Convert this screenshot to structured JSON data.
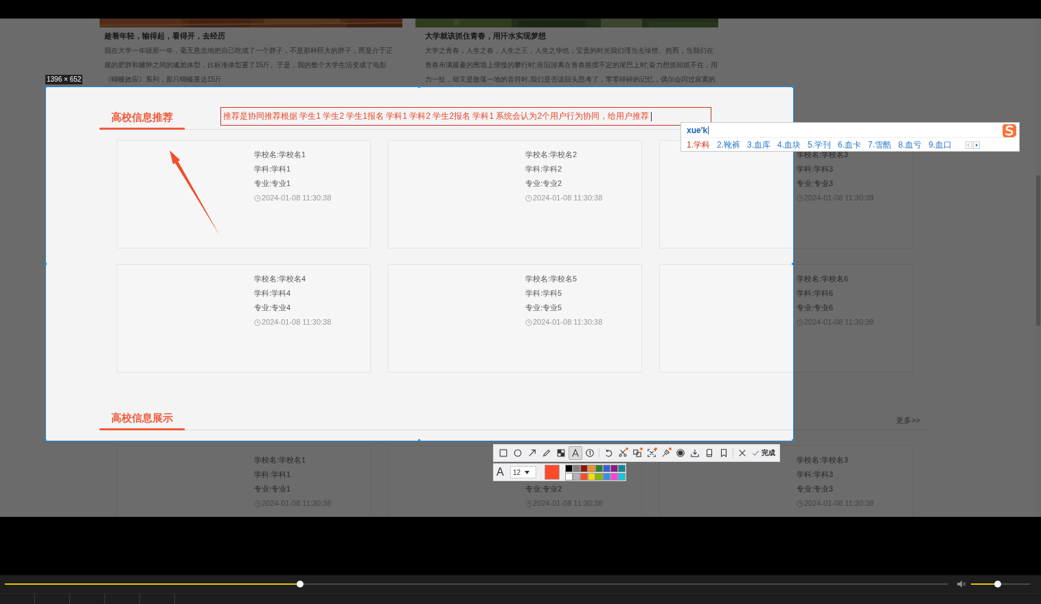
{
  "page": {
    "articles": [
      {
        "title": "趁着年轻，输得起，看得开，去经历",
        "lines": [
          "我在大学一年级那一年，毫无悬念地把自己吃成了一个胖子，不是那种巨大的胖子，而是介于正",
          "规的肥胖和臃肿之间的尴尬体型，比标准体型重了15斤。于是，我的整个大学生活变成了电影",
          "《蝴蝶效应》系列，那只蝴蝶重达15斤"
        ]
      },
      {
        "title": "大学就该抓住青春，用汗水实现梦想",
        "lines": [
          "大学之青春，人生之春，人生之王，人生之华也，宝贵的时光我们理当去珍惜。然而，当我们在",
          "青春布满藤蔓的围墙上缓慢的攀行时;依旧游离在青春摇摆不定的尾巴上时;奋力想抓却抓不住，用",
          "力一扯，却又是散落一地的音符时,我们是否该回头思考了，零零碎碎的记忆，偶尔会闪过寂寞的"
        ]
      }
    ],
    "sections": [
      {
        "title": "高校信息推荐",
        "cards": [
          {
            "school": "学校名:学校名1",
            "subject": "学科:学科1",
            "major": "专业:专业1",
            "time": "2024-01-08 11:30:38"
          },
          {
            "school": "学校名:学校名2",
            "subject": "学科:学科2",
            "major": "专业:专业2",
            "time": "2024-01-08 11:30:38"
          },
          {
            "school": "学校名:学校名3",
            "subject": "学科:学科3",
            "major": "专业:专业3",
            "time": "2024-01-08 11:30:38"
          },
          {
            "school": "学校名:学校名4",
            "subject": "学科:学科4",
            "major": "专业:专业4",
            "time": "2024-01-08 11:30:38"
          },
          {
            "school": "学校名:学校名5",
            "subject": "学科:学科5",
            "major": "专业:专业5",
            "time": "2024-01-08 11:30:38"
          },
          {
            "school": "学校名:学校名6",
            "subject": "学科:学科6",
            "major": "专业:专业6",
            "time": "2024-01-08 11:30:38"
          }
        ]
      },
      {
        "title": "高校信息展示",
        "more": "更多>>",
        "cards": [
          {
            "school": "学校名:学校名1",
            "subject": "学科:学科1",
            "major": "专业:专业1",
            "time": "2024-01-08 11:30:38"
          },
          {
            "major": "专业:专业2",
            "time": "2024-01-08 11:30:38"
          },
          {
            "school": "学校名:学校名3",
            "subject": "学科:学科3",
            "major": "专业:专业3",
            "time": "2024-01-08 11:30:38"
          }
        ]
      }
    ]
  },
  "screenshot_tool": {
    "size_label": "1396 × 652",
    "annotation_text": "推荐是协同推荐根据 学生1 学生2 学生1报名 学科1 学科2 学生2报名 学科1  系统会认为2个用户行为协同，给用户推荐",
    "toolbar": {
      "groups": [
        {
          "tools": [
            {
              "kind": "rectangle",
              "selected": false,
              "dot": false
            },
            {
              "kind": "ellipse",
              "selected": false,
              "dot": false
            },
            {
              "kind": "arrow",
              "selected": false,
              "dot": false
            },
            {
              "kind": "pen",
              "selected": false,
              "dot": false
            },
            {
              "kind": "mosaic",
              "selected": false,
              "dot": false
            },
            {
              "kind": "text",
              "selected": true,
              "dot": false
            },
            {
              "kind": "serial",
              "selected": false,
              "dot": false
            }
          ]
        },
        {
          "tools": [
            {
              "kind": "undo",
              "selected": false,
              "dot": false
            },
            {
              "kind": "cut",
              "selected": false,
              "dot": true
            },
            {
              "kind": "translate",
              "selected": false,
              "dot": true
            },
            {
              "kind": "capture",
              "selected": false,
              "dot": true
            },
            {
              "kind": "pin",
              "selected": false,
              "dot": true
            },
            {
              "kind": "record",
              "selected": false,
              "dot": false
            },
            {
              "kind": "save",
              "selected": false,
              "dot": false
            },
            {
              "kind": "phone",
              "selected": false,
              "dot": false
            },
            {
              "kind": "bookmark",
              "selected": false,
              "dot": false
            }
          ]
        },
        {
          "tools": [
            {
              "kind": "close",
              "selected": false,
              "dot": false
            }
          ]
        }
      ],
      "done_label": "完成",
      "font_icon": "A",
      "font_size": "12",
      "current": {
        "color": "#ff4a2a"
      },
      "palette": [
        {
          "color": "#000000"
        },
        {
          "color": "#808080"
        },
        {
          "color": "#8b1a0a"
        },
        {
          "color": "#f0902a"
        },
        {
          "color": "#2e7d32"
        },
        {
          "color": "#3a5bd9"
        },
        {
          "color": "#8a1a8a"
        },
        {
          "color": "#0a8a9a"
        },
        {
          "color": "#ffffff"
        },
        {
          "color": "#b4b4b4"
        },
        {
          "color": "#ff4a2a"
        },
        {
          "color": "#f0e000"
        },
        {
          "color": "#8ab800"
        },
        {
          "color": "#3a90e0"
        },
        {
          "color": "#ff40e0"
        },
        {
          "color": "#10c8e0"
        }
      ]
    }
  },
  "ime": {
    "composition": "xue'k",
    "candidates": [
      {
        "text": "1.学科",
        "selected": true
      },
      {
        "text": "2.靴裤",
        "selected": false
      },
      {
        "text": "3.血库",
        "selected": false
      },
      {
        "text": "4.血块",
        "selected": false
      },
      {
        "text": "5.学刊",
        "selected": false
      },
      {
        "text": "6.血卡",
        "selected": false
      },
      {
        "text": "7.雪酷",
        "selected": false
      },
      {
        "text": "8.血亏",
        "selected": false
      },
      {
        "text": "9.血口",
        "selected": false
      }
    ]
  },
  "player": {
    "progress": {
      "level": 0.312
    },
    "volume": {
      "level": 0.45
    }
  }
}
